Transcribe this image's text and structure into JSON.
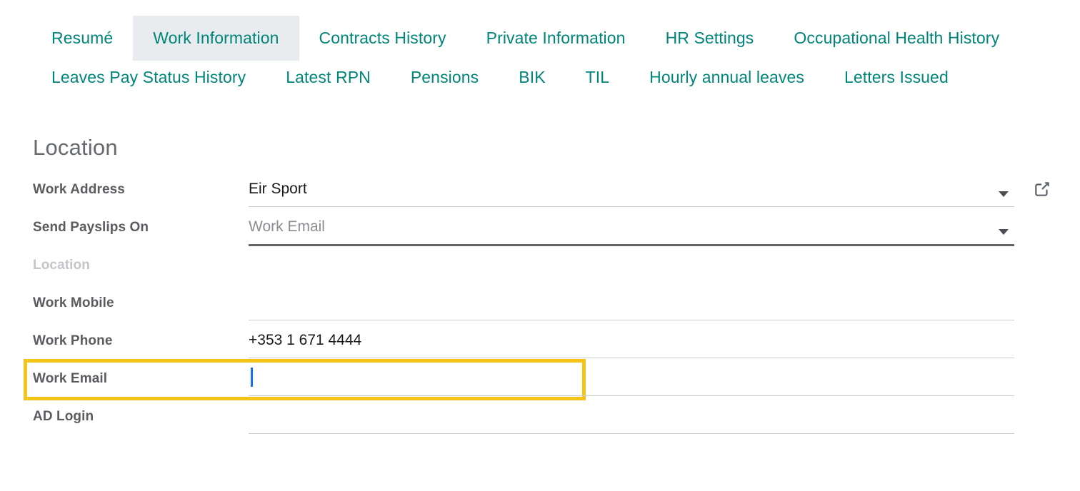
{
  "theme": {
    "accent_teal": "#00857a",
    "active_tab_bg": "#e9ecef",
    "highlight_yellow": "#f6c418",
    "caret_blue": "#1a73e8",
    "label_gray": "#5a5c60",
    "muted_gray": "#c3c5c8"
  },
  "notebook": {
    "rows": [
      {
        "tabs": [
          {
            "label": "Resumé",
            "active": false
          },
          {
            "label": "Work Information",
            "active": true
          },
          {
            "label": "Contracts History",
            "active": false
          },
          {
            "label": "Private Information",
            "active": false
          },
          {
            "label": "HR Settings",
            "active": false
          },
          {
            "label": "Occupational Health History",
            "active": false
          }
        ]
      },
      {
        "tabs": [
          {
            "label": "Leaves Pay Status History",
            "active": false
          },
          {
            "label": "Latest RPN",
            "active": false
          },
          {
            "label": "Pensions",
            "active": false
          },
          {
            "label": "BIK",
            "active": false
          },
          {
            "label": "TIL",
            "active": false
          },
          {
            "label": "Hourly annual leaves",
            "active": false
          },
          {
            "label": "Letters Issued",
            "active": false
          }
        ]
      }
    ]
  },
  "form": {
    "group_title": "Location",
    "fields": [
      {
        "label": "Work Address",
        "value": "Eir Sport",
        "placeholder": "",
        "label_muted": false,
        "is_placeholder_value": false,
        "has_dropdown": true,
        "has_external_link": true,
        "underline": "normal",
        "focused": false,
        "caret": false
      },
      {
        "label": "Send Payslips On",
        "value": "Work Email",
        "placeholder": "",
        "label_muted": false,
        "is_placeholder_value": true,
        "has_dropdown": true,
        "has_external_link": false,
        "underline": "strong",
        "focused": false,
        "caret": false
      },
      {
        "label": "Location",
        "value": "",
        "placeholder": "",
        "label_muted": true,
        "is_placeholder_value": false,
        "has_dropdown": false,
        "has_external_link": false,
        "underline": "none",
        "focused": false,
        "caret": false
      },
      {
        "label": "Work Mobile",
        "value": "",
        "placeholder": "",
        "label_muted": false,
        "is_placeholder_value": false,
        "has_dropdown": false,
        "has_external_link": false,
        "underline": "normal",
        "focused": false,
        "caret": false
      },
      {
        "label": "Work Phone",
        "value": "+353 1 671 4444",
        "placeholder": "",
        "label_muted": false,
        "is_placeholder_value": false,
        "has_dropdown": false,
        "has_external_link": false,
        "underline": "normal",
        "focused": false,
        "caret": false
      },
      {
        "label": "Work Email",
        "value": "",
        "placeholder": "",
        "label_muted": false,
        "is_placeholder_value": false,
        "has_dropdown": false,
        "has_external_link": false,
        "underline": "normal",
        "focused": true,
        "caret": true
      },
      {
        "label": "AD Login",
        "value": "",
        "placeholder": "",
        "label_muted": false,
        "is_placeholder_value": false,
        "has_dropdown": false,
        "has_external_link": false,
        "underline": "normal",
        "focused": false,
        "caret": false
      }
    ]
  },
  "icons": {
    "dropdown": "chevron-down-icon",
    "external_link": "external-link-icon",
    "text_caret": "text-cursor"
  }
}
